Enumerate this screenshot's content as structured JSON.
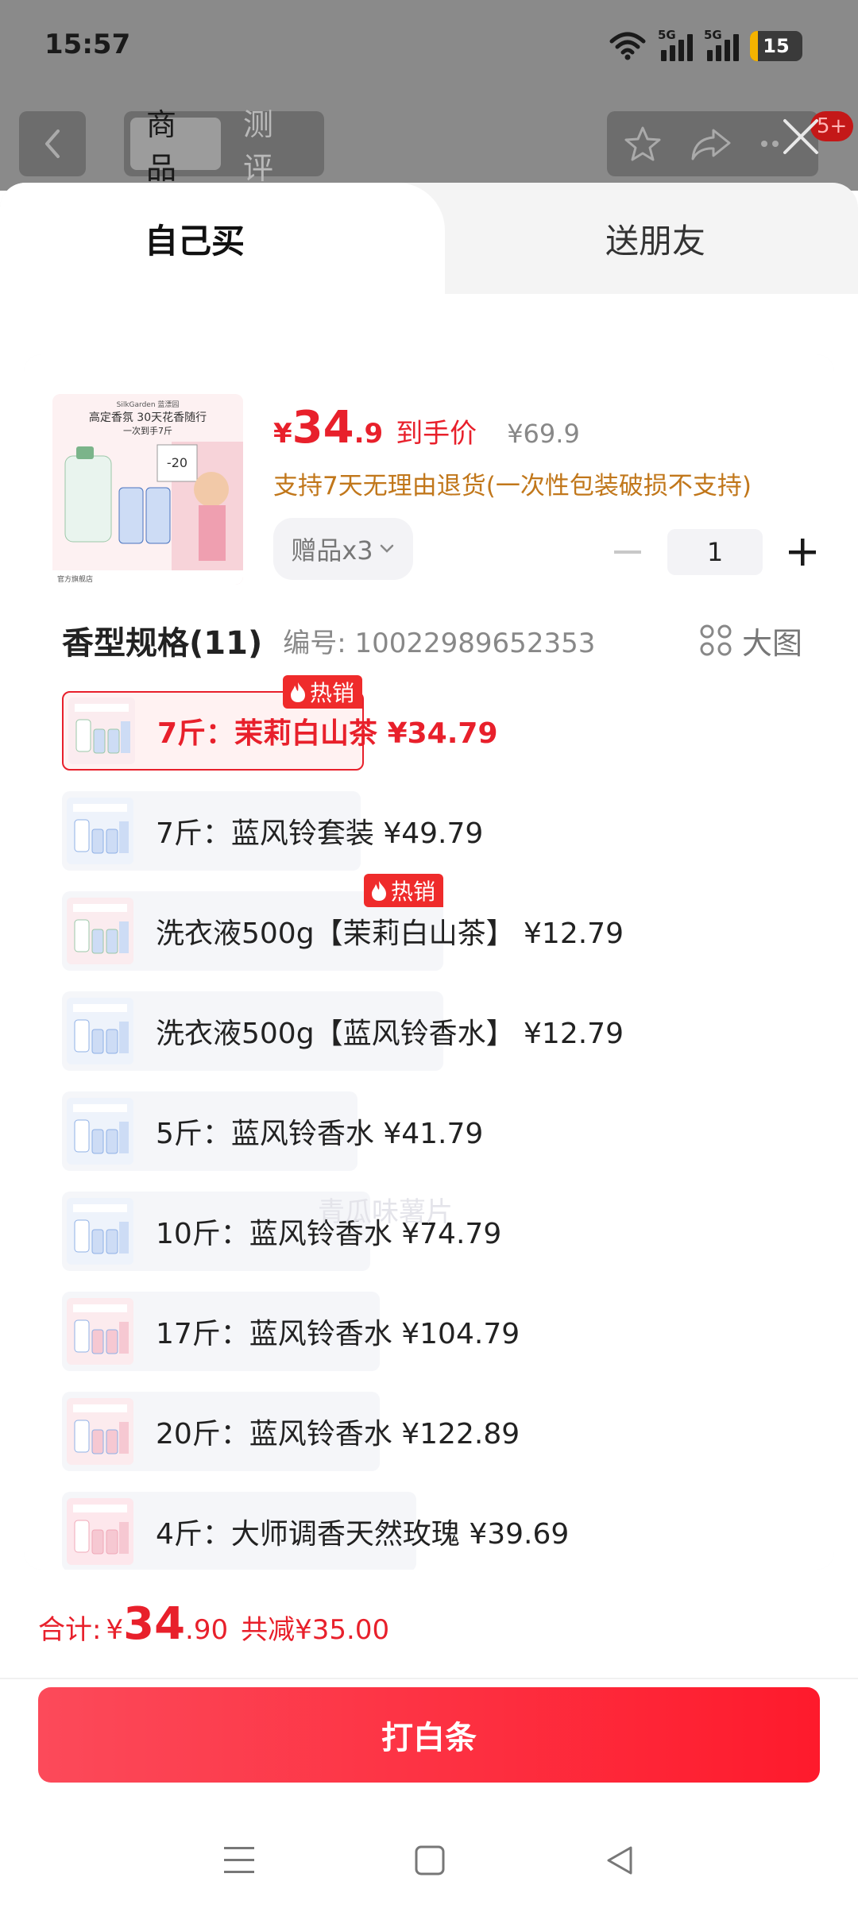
{
  "status_bar": {
    "time": "15:57",
    "signal1_tag": "5G",
    "signal2_tag": "5G",
    "battery": "15"
  },
  "top_nav": {
    "tabs": [
      {
        "label": "商品"
      },
      {
        "label": "测评"
      }
    ],
    "badge": "5+"
  },
  "sheet": {
    "mode_tabs": [
      {
        "label": "自己买"
      },
      {
        "label": "送朋友"
      }
    ],
    "product": {
      "price_yen": "¥",
      "price_int": "34",
      "price_dec": ".9",
      "price_label": "到手价",
      "original_price": "¥69.9",
      "return_policy": "支持7天无理由退货(一次性包装破损不支持)",
      "gift": "赠品x3",
      "quantity": "1",
      "thumb": {
        "brand": "SilkGarden 蓝漂园",
        "headline": "高定香氛 30天花香随行",
        "subline": "一次到手7斤",
        "promo": "-20",
        "footer": "官方旗舰店"
      }
    },
    "spec": {
      "title": "香型规格(11)",
      "code": "编号: 10022989652353",
      "big_view": "大图",
      "hot_label": "热销",
      "options": [
        {
          "label": "7斤：茉莉白山茶  ¥34.79",
          "selected": true,
          "hot": true,
          "theme": "pink"
        },
        {
          "label": "7斤：蓝风铃套装  ¥49.79",
          "selected": false,
          "hot": false,
          "theme": "blue"
        },
        {
          "label": "洗衣液500g【茉莉白山茶】  ¥12.79",
          "selected": false,
          "hot": true,
          "theme": "pink"
        },
        {
          "label": "洗衣液500g【蓝风铃香水】  ¥12.79",
          "selected": false,
          "hot": false,
          "theme": "blue"
        },
        {
          "label": "5斤：蓝风铃香水  ¥41.79",
          "selected": false,
          "hot": false,
          "theme": "blue"
        },
        {
          "label": "10斤：蓝风铃香水  ¥74.79",
          "selected": false,
          "hot": false,
          "theme": "blue"
        },
        {
          "label": "17斤：蓝风铃香水  ¥104.79",
          "selected": false,
          "hot": false,
          "theme": "pinkblue"
        },
        {
          "label": "20斤：蓝风铃香水  ¥122.89",
          "selected": false,
          "hot": false,
          "theme": "pinkblue"
        },
        {
          "label": "4斤：大师调香天然玫瑰  ¥39.69",
          "selected": false,
          "hot": false,
          "theme": "rose"
        }
      ]
    },
    "watermark": "青瓜味薯片"
  },
  "footer": {
    "total_label": "合计:",
    "total_yen": "¥",
    "total_int": "34",
    "total_dec": ".90",
    "discount": "共减¥35.00",
    "pay_button": "打白条"
  },
  "colors": {
    "accent": "#e8202b",
    "gold_note": "#c1771b",
    "hot_tag": "#ef2b2b"
  },
  "icons": [
    "wifi-icon",
    "signal-icon",
    "battery-icon",
    "back-icon",
    "star-icon",
    "share-icon",
    "more-icon",
    "close-icon",
    "chevron-down-icon",
    "minus-icon",
    "plus-icon",
    "grid-icon",
    "flame-icon",
    "menu-icon",
    "home-icon",
    "back-triangle-icon"
  ]
}
